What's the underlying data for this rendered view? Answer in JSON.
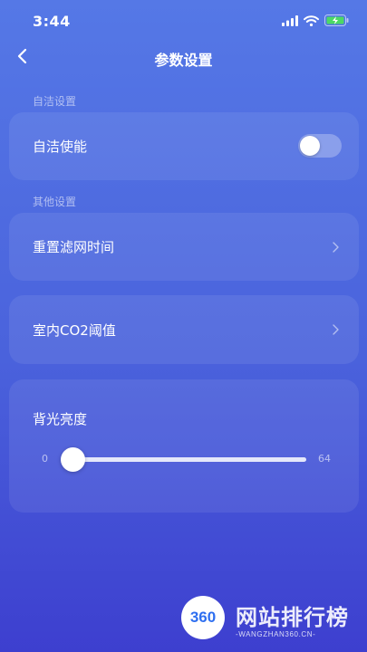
{
  "status_bar": {
    "time": "3:44",
    "icons": [
      "signal-icon",
      "wifi-icon",
      "battery-charging-icon"
    ],
    "battery_color": "#4cd964"
  },
  "header": {
    "title": "参数设置",
    "back_icon": "chevron-left-icon"
  },
  "sections": {
    "self_clean": {
      "label": "自洁设置",
      "enable_label": "自洁使能",
      "enabled": false
    },
    "other": {
      "label": "其他设置",
      "filter_reset_label": "重置滤网时间",
      "co2_threshold_label": "室内CO2阈值"
    },
    "backlight": {
      "label": "背光亮度",
      "min": "0",
      "max": "64",
      "value": 0
    }
  },
  "watermark": {
    "logo": "360",
    "text": "网站排行榜",
    "sub": "-WANGZHAN360.CN-"
  },
  "colors": {
    "background_top": "#5578e6",
    "background_bottom": "#3d3fcf",
    "text": "#ffffff"
  }
}
